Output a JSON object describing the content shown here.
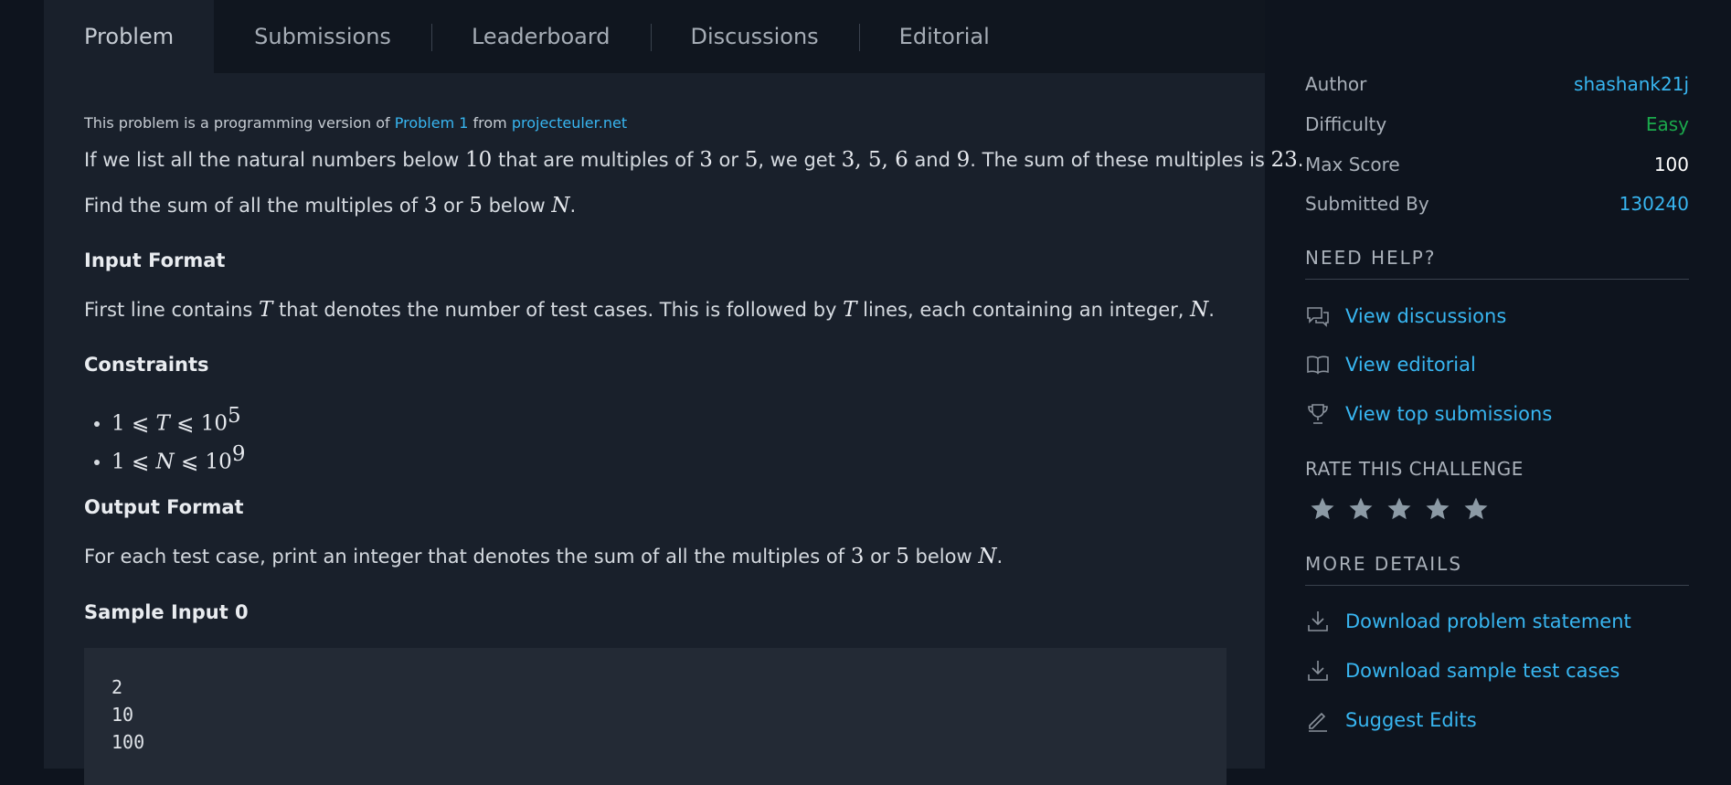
{
  "tabs": [
    "Problem",
    "Submissions",
    "Leaderboard",
    "Discussions",
    "Editorial"
  ],
  "problem": {
    "note_prefix": "This problem is a programming version of ",
    "note_link1": "Problem 1",
    "note_mid": " from ",
    "note_link2": "projecteuler.net",
    "para1": [
      "If we list all the natural numbers below ",
      "10",
      " that are multiples of ",
      "3",
      " or ",
      "5",
      ", we get ",
      "3, 5, 6",
      " and ",
      "9",
      ". The sum of these multiples is ",
      "23",
      "."
    ],
    "para2": [
      "Find the sum of all the multiples of ",
      "3",
      " or ",
      "5",
      " below ",
      "N",
      "."
    ],
    "input_heading": "Input Format",
    "input_text": [
      "First line contains ",
      "T",
      " that denotes the number of test cases. This is followed by ",
      "T",
      " lines, each containing an integer, ",
      "N",
      "."
    ],
    "constraints_heading": "Constraints",
    "constraints": [
      {
        "lhs": "1 ⩽ ",
        "var": "T",
        "rhs": " ⩽ 10",
        "exp": "5"
      },
      {
        "lhs": "1 ⩽ ",
        "var": "N",
        "rhs": " ⩽ 10",
        "exp": "9"
      }
    ],
    "output_heading": "Output Format",
    "output_text": [
      "For each test case, print an integer that denotes the sum of all the multiples of ",
      "3",
      " or ",
      "5",
      " below ",
      "N",
      "."
    ],
    "sample_input_heading": "Sample Input 0",
    "sample_input": "2\n10\n100"
  },
  "sidebar": {
    "author_label": "Author",
    "author_value": "shashank21j",
    "difficulty_label": "Difficulty",
    "difficulty_value": "Easy",
    "maxscore_label": "Max Score",
    "maxscore_value": "100",
    "submitted_label": "Submitted By",
    "submitted_value": "130240",
    "need_help": "NEED HELP?",
    "view_discussions": "View discussions",
    "view_editorial": "View editorial",
    "view_top": "View top submissions",
    "rate": "RATE THIS CHALLENGE",
    "stars_count": 5,
    "more_details": "MORE DETAILS",
    "download_statement": "Download problem statement",
    "download_tests": "Download sample test cases",
    "suggest_edits": "Suggest Edits"
  },
  "colors": {
    "link": "#38b6f1",
    "easy": "#1ba94c",
    "background": "#0e141e",
    "panel": "#19202b"
  }
}
